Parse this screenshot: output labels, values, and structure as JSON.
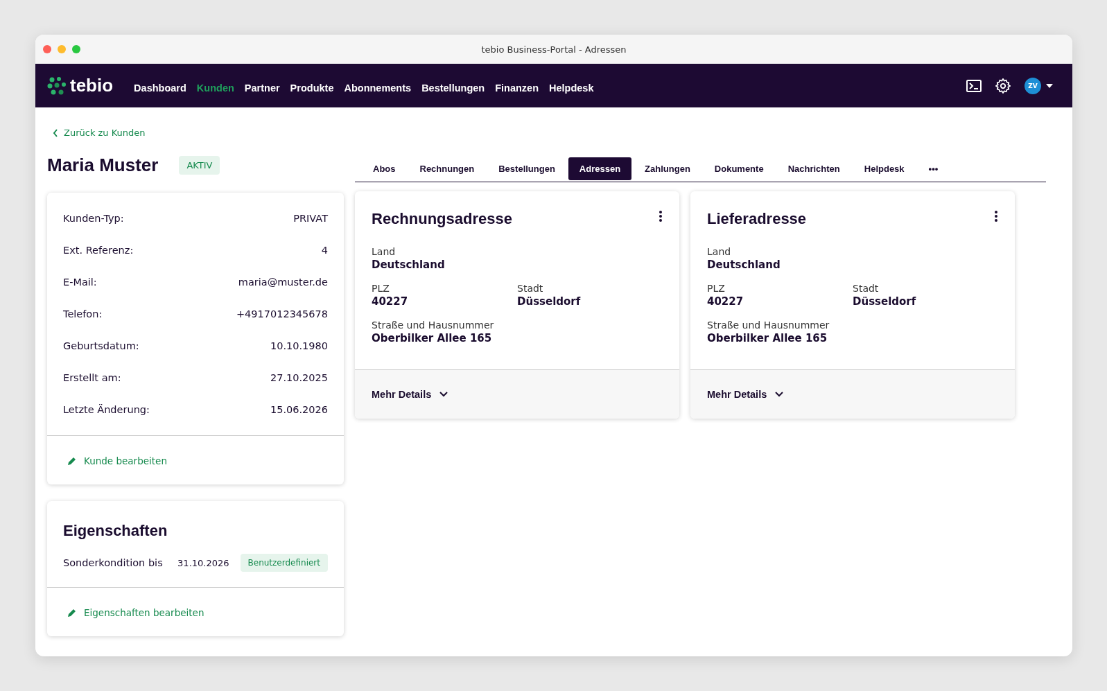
{
  "window": {
    "title": "tebio Business-Portal - Adressen"
  },
  "brand": "tebio",
  "nav": [
    {
      "label": "Dashboard",
      "selected": false
    },
    {
      "label": "Kunden",
      "selected": true
    },
    {
      "label": "Partner",
      "selected": false
    },
    {
      "label": "Produkte",
      "selected": false
    },
    {
      "label": "Abonnements",
      "selected": false
    },
    {
      "label": "Bestellungen",
      "selected": false
    },
    {
      "label": "Finanzen",
      "selected": false
    },
    {
      "label": "Helpdesk",
      "selected": false
    }
  ],
  "user": {
    "initials": "ZV"
  },
  "back_link": "Zurück zu Kunden",
  "customer": {
    "name": "Maria Muster",
    "status": "AKTIV"
  },
  "details": [
    {
      "label": "Kunden-Typ:",
      "value": "PRIVAT"
    },
    {
      "label": "Ext. Referenz:",
      "value": "4"
    },
    {
      "label": "E-Mail:",
      "value": "maria@muster.de"
    },
    {
      "label": "Telefon:",
      "value": "+4917012345678"
    },
    {
      "label": "Geburtsdatum:",
      "value": "10.10.1980"
    },
    {
      "label": "Erstellt am:",
      "value": "27.10.2025"
    },
    {
      "label": "Letzte Änderung:",
      "value": "15.06.2026"
    }
  ],
  "edit_customer": "Kunde bearbeiten",
  "properties": {
    "title": "Eigenschaften",
    "rows": [
      {
        "label": "Sonderkondition bis",
        "date": "31.10.2026",
        "tag": "Benutzerdefiniert"
      }
    ],
    "edit": "Eigenschaften bearbeiten"
  },
  "tabs": [
    {
      "label": "Abos",
      "selected": false
    },
    {
      "label": "Rechnungen",
      "selected": false
    },
    {
      "label": "Bestellungen",
      "selected": false
    },
    {
      "label": "Adressen",
      "selected": true
    },
    {
      "label": "Zahlungen",
      "selected": false
    },
    {
      "label": "Dokumente",
      "selected": false
    },
    {
      "label": "Nachrichten",
      "selected": false
    },
    {
      "label": "Helpdesk",
      "selected": false
    },
    {
      "label": "•••",
      "selected": false
    }
  ],
  "addresses": [
    {
      "title": "Rechnungsadresse",
      "fields": [
        {
          "label": "Land",
          "value": "Deutschland",
          "span": true
        },
        {
          "label": "PLZ",
          "value": "40227",
          "span": false
        },
        {
          "label": "Stadt",
          "value": "Düsseldorf",
          "span": false
        },
        {
          "label": "Straße und Hausnummer",
          "value": "Oberbilker Allee 165",
          "span": true
        }
      ],
      "more": "Mehr Details"
    },
    {
      "title": "Lieferadresse",
      "fields": [
        {
          "label": "Land",
          "value": "Deutschland",
          "span": true
        },
        {
          "label": "PLZ",
          "value": "40227",
          "span": false
        },
        {
          "label": "Stadt",
          "value": "Düsseldorf",
          "span": false
        },
        {
          "label": "Straße und Hausnummer",
          "value": "Oberbilker Allee 165",
          "span": true
        }
      ],
      "more": "Mehr Details"
    }
  ]
}
